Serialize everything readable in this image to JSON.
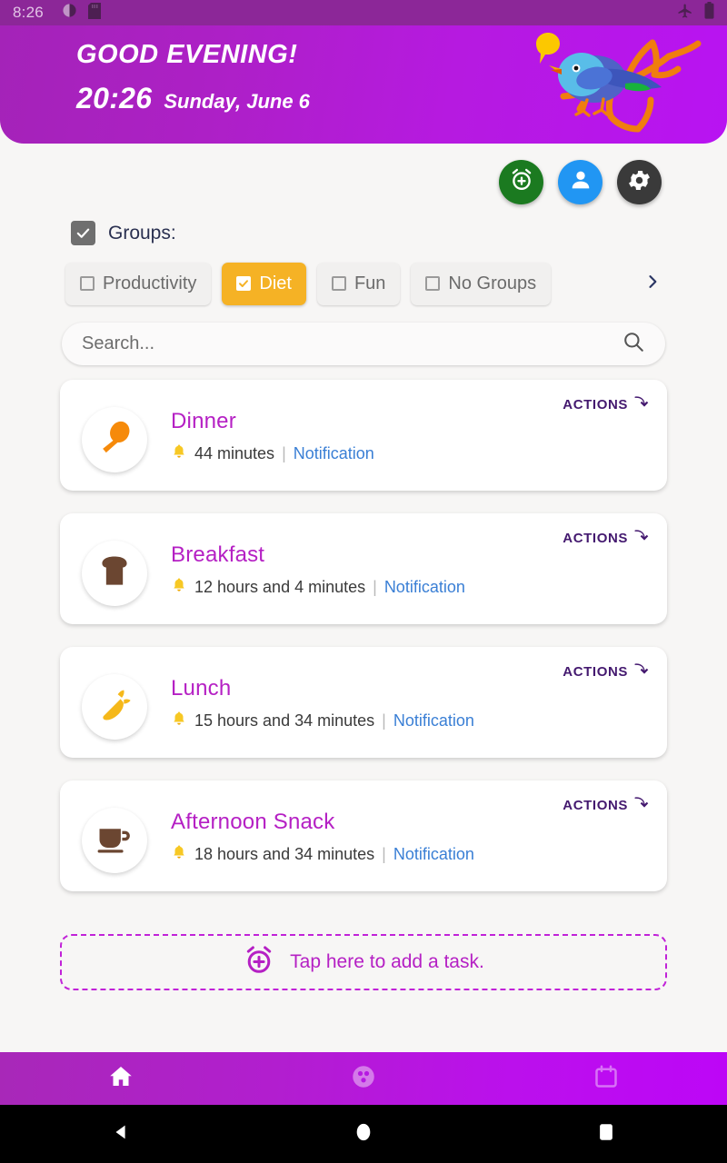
{
  "status_bar": {
    "time": "8:26",
    "icons": [
      "contrast-icon",
      "sd-card-icon"
    ],
    "right_icons": [
      "airplane-mode-icon",
      "battery-icon"
    ]
  },
  "header": {
    "greeting": "GOOD EVENING!",
    "clock": "20:26",
    "date": "Sunday, June 6",
    "illustration": "bird-on-branch-illustration",
    "gradient_start": "#a423b8",
    "gradient_end": "#b813f2"
  },
  "quick_actions": [
    {
      "name": "add-alarm-button",
      "icon": "alarm-plus-icon",
      "color": "#1b7a20"
    },
    {
      "name": "profile-button",
      "icon": "person-icon",
      "color": "#2196f3"
    },
    {
      "name": "settings-button",
      "icon": "gear-icon",
      "color": "#3a3a3a"
    }
  ],
  "groups": {
    "label": "Groups:",
    "checkbox_checked": true,
    "chips": [
      {
        "label": "Productivity",
        "checked": false
      },
      {
        "label": "Diet",
        "checked": true
      },
      {
        "label": "Fun",
        "checked": false
      },
      {
        "label": "No Groups",
        "checked": false
      }
    ],
    "more_icon": "chevron-right-icon",
    "active_color": "#f5b225"
  },
  "search": {
    "placeholder": "Search...",
    "value": "",
    "icon": "search-icon"
  },
  "tasks": [
    {
      "title": "Dinner",
      "time": "44 minutes",
      "separator": "|",
      "notification": "Notification",
      "actions_label": "ACTIONS",
      "icon": "spoon-icon",
      "icon_color": "#f68a0a"
    },
    {
      "title": "Breakfast",
      "time": "12 hours and 4 minutes",
      "separator": "|",
      "notification": "Notification",
      "actions_label": "ACTIONS",
      "icon": "bread-icon",
      "icon_color": "#6b4631"
    },
    {
      "title": "Lunch",
      "time": "15 hours and 34 minutes",
      "separator": "|",
      "notification": "Notification",
      "actions_label": "ACTIONS",
      "icon": "carrot-icon",
      "icon_color": "#f5b81a"
    },
    {
      "title": "Afternoon Snack",
      "time": "18 hours and 34 minutes",
      "separator": "|",
      "notification": "Notification",
      "actions_label": "ACTIONS",
      "icon": "coffee-cup-icon",
      "icon_color": "#6b4631"
    }
  ],
  "add_task": {
    "label": "Tap here to add a task.",
    "icon": "alarm-plus-icon",
    "color": "#b520c4"
  },
  "bottom_nav": [
    {
      "name": "home",
      "icon": "home-icon",
      "active": true
    },
    {
      "name": "groups",
      "icon": "groups-circle-icon",
      "active": false
    },
    {
      "name": "calendar",
      "icon": "calendar-icon",
      "active": false
    }
  ],
  "android_nav": [
    {
      "name": "back",
      "icon": "back-triangle-icon"
    },
    {
      "name": "home",
      "icon": "home-circle-icon"
    },
    {
      "name": "recents",
      "icon": "recents-square-icon"
    }
  ]
}
